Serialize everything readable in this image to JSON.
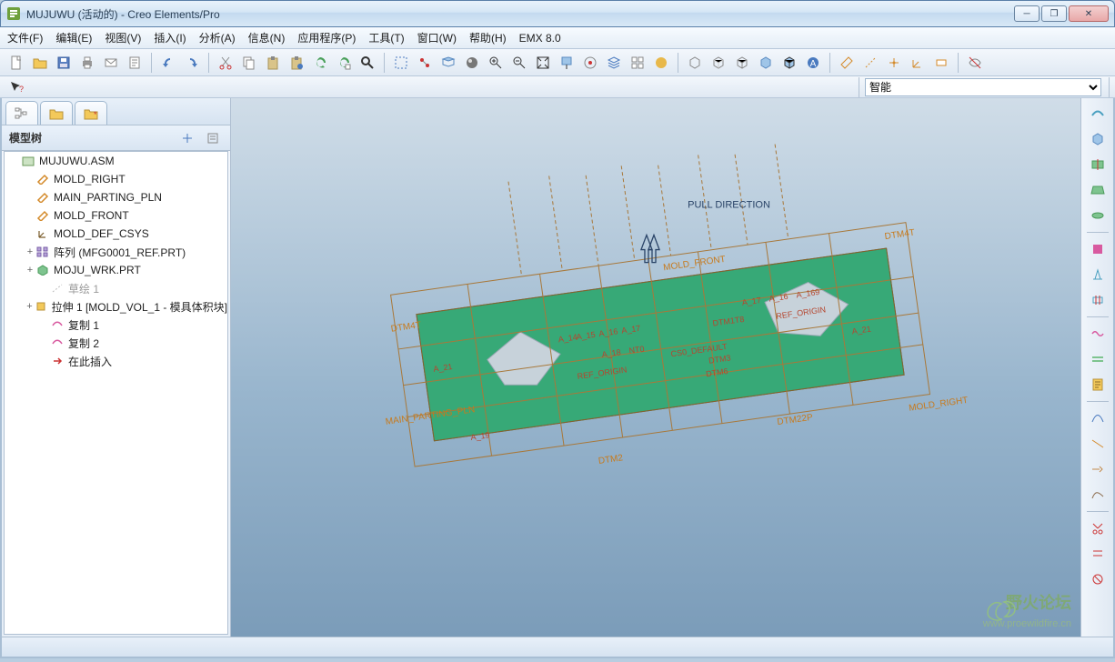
{
  "window": {
    "title": "MUJUWU (活动的) - Creo Elements/Pro"
  },
  "menu": {
    "items": [
      "文件(F)",
      "编辑(E)",
      "视图(V)",
      "插入(I)",
      "分析(A)",
      "信息(N)",
      "应用程序(P)",
      "工具(T)",
      "窗口(W)",
      "帮助(H)",
      "EMX 8.0"
    ]
  },
  "toolbar": {
    "new": "新建",
    "open": "打开",
    "save": "保存",
    "print": "打印",
    "email": "邮件",
    "setup": "设置",
    "undo": "撤销",
    "redo": "重做",
    "cut": "剪切",
    "copy": "复制",
    "paste": "粘贴",
    "paste_special": "选择性粘贴",
    "regen": "再生",
    "regen_mgr": "再生管理",
    "find": "查找",
    "select": "选择",
    "chain": "链",
    "surf": "曲面集",
    "shade": "显示样式",
    "prev": "上一视图",
    "refit": "重新调整",
    "zoomin": "放大",
    "zoomout": "缩小",
    "repaint": "重画",
    "spin": "旋转中心",
    "layers": "层",
    "view_mgr": "视图管理器",
    "appearance": "外观",
    "annot": "注释",
    "disp_wire": "线框",
    "disp_hidden": "隐藏线",
    "disp_nohidden": "无隐藏线",
    "disp_shade": "着色",
    "disp_shade_edges": "带边着色",
    "datum_plane": "基准平面显示",
    "datum_axis": "基准轴显示",
    "datum_point": "基准点显示",
    "datum_csys": "坐标系显示",
    "datum_tag": "基准标记",
    "model_disp": "模型显示",
    "help_cursor": "上下文帮助"
  },
  "combo": {
    "smart_label": "智能"
  },
  "sidebar": {
    "header": "模型树",
    "root": "MUJUWU.ASM",
    "items": [
      {
        "label": "MOLD_RIGHT",
        "icon": "datum-plane"
      },
      {
        "label": "MAIN_PARTING_PLN",
        "icon": "datum-plane"
      },
      {
        "label": "MOLD_FRONT",
        "icon": "datum-plane"
      },
      {
        "label": "MOLD_DEF_CSYS",
        "icon": "csys"
      },
      {
        "label": "阵列 (MFG0001_REF.PRT)",
        "icon": "pattern",
        "expand": "+"
      },
      {
        "label": "MOJU_WRK.PRT",
        "icon": "part",
        "expand": "+"
      },
      {
        "label": "草绘 1",
        "icon": "sketch",
        "gray": true
      },
      {
        "label": "拉伸 1 [MOLD_VOL_1 - 模具体积块]",
        "icon": "extrude",
        "expand": "+"
      },
      {
        "label": "复制 1",
        "icon": "copy"
      },
      {
        "label": "复制 2",
        "icon": "copy"
      },
      {
        "label": "在此插入",
        "icon": "insert-here"
      }
    ]
  },
  "viewport": {
    "pull_direction": "PULL DIRECTION",
    "labels": {
      "mold_right": "MOLD_RIGHT",
      "mold_front": "MOLD_FRONT",
      "main_parting_pln": "MAIN_PARTING_PLN",
      "dtm4t_a": "DTM4T",
      "dtm4t_b": "DTM4T",
      "dtm1t8": "DTM1T8",
      "dtm2": "DTM2",
      "dtm22p": "DTM22P",
      "dtm3": "DTM3",
      "dtm6": "DTM6",
      "cs0_default": "CS0_DEFAULT",
      "ref_origin1": "REF_ORIGIN",
      "ref_origin2": "REF_ORIGIN",
      "a14": "A_14",
      "a15": "A_15",
      "a16": "A_16",
      "a17": "A_17",
      "a18": "A_18",
      "a172": "A_17",
      "a162": "A_16",
      "a169": "A_169",
      "a19": "A_19",
      "a21": "A_21",
      "a21b": "A_21",
      "nt0": "NT0"
    }
  },
  "watermark": {
    "title": "野火论坛",
    "subtitle": "www.proewildfire.cn"
  },
  "right_toolbar": {
    "items": [
      "分型面",
      "体积块",
      "切割",
      "裙边",
      "填充",
      "着色体积",
      "拔模检测",
      "厚度检测",
      "水线",
      "冷却",
      "曲线1",
      "曲线2",
      "延伸",
      "合并",
      "修剪",
      "偏移",
      "显示"
    ]
  },
  "colors": {
    "accent": "#3b6ea5",
    "surface_green": "#37a977",
    "datum_orange": "#c77a1c",
    "text_red": "#b5462f"
  }
}
